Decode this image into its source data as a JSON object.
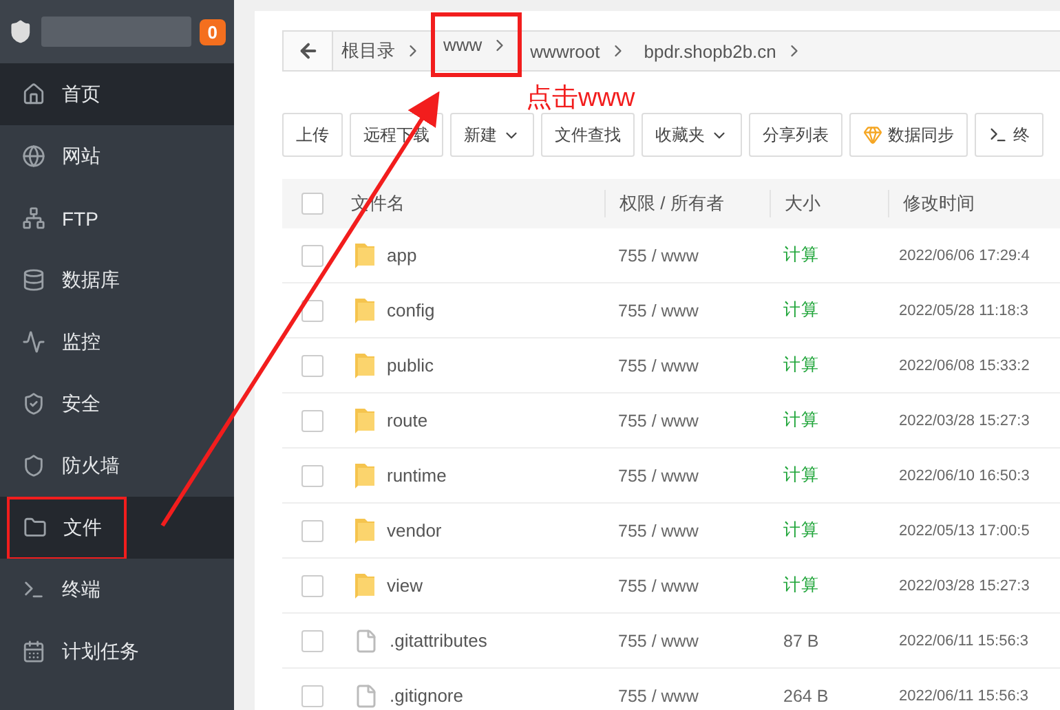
{
  "sidebar": {
    "badge": "0",
    "items": [
      {
        "label": "首页",
        "selected": true,
        "highlighted": false
      },
      {
        "label": "网站",
        "selected": false,
        "highlighted": false
      },
      {
        "label": "FTP",
        "selected": false,
        "highlighted": false
      },
      {
        "label": "数据库",
        "selected": false,
        "highlighted": false
      },
      {
        "label": "监控",
        "selected": false,
        "highlighted": false
      },
      {
        "label": "安全",
        "selected": false,
        "highlighted": false
      },
      {
        "label": "防火墙",
        "selected": false,
        "highlighted": false
      },
      {
        "label": "文件",
        "selected": true,
        "highlighted": true
      },
      {
        "label": "终端",
        "selected": false,
        "highlighted": false
      },
      {
        "label": "计划任务",
        "selected": false,
        "highlighted": false
      }
    ]
  },
  "breadcrumb": [
    {
      "label": "根目录",
      "highlighted": false
    },
    {
      "label": "www",
      "highlighted": true
    },
    {
      "label": "wwwroot",
      "highlighted": false
    },
    {
      "label": "bpdr.shopb2b.cn",
      "highlighted": false
    }
  ],
  "annotation": {
    "text": "点击www"
  },
  "toolbar": [
    {
      "label": "上传",
      "kind": "plain"
    },
    {
      "label": "远程下载",
      "kind": "plain"
    },
    {
      "label": "新建",
      "kind": "dropdown"
    },
    {
      "label": "文件查找",
      "kind": "plain"
    },
    {
      "label": "收藏夹",
      "kind": "dropdown"
    },
    {
      "label": "分享列表",
      "kind": "plain"
    },
    {
      "label": "数据同步",
      "kind": "gem"
    },
    {
      "label": "终",
      "kind": "terminal"
    }
  ],
  "table": {
    "select_all_checked": false,
    "columns": [
      "文件名",
      "权限 / 所有者",
      "大小",
      "修改时间"
    ],
    "rows": [
      {
        "kind": "folder",
        "name": "app",
        "perm": "755 / www",
        "size": "计算",
        "time": "2022/06/06 17:29:4",
        "checked": false
      },
      {
        "kind": "folder",
        "name": "config",
        "perm": "755 / www",
        "size": "计算",
        "time": "2022/05/28 11:18:3",
        "checked": false
      },
      {
        "kind": "folder",
        "name": "public",
        "perm": "755 / www",
        "size": "计算",
        "time": "2022/06/08 15:33:2",
        "checked": false
      },
      {
        "kind": "folder",
        "name": "route",
        "perm": "755 / www",
        "size": "计算",
        "time": "2022/03/28 15:27:3",
        "checked": false
      },
      {
        "kind": "folder",
        "name": "runtime",
        "perm": "755 / www",
        "size": "计算",
        "time": "2022/06/10 16:50:3",
        "checked": false
      },
      {
        "kind": "folder",
        "name": "vendor",
        "perm": "755 / www",
        "size": "计算",
        "time": "2022/05/13 17:00:5",
        "checked": false
      },
      {
        "kind": "folder",
        "name": "view",
        "perm": "755 / www",
        "size": "计算",
        "time": "2022/03/28 15:27:3",
        "checked": false
      },
      {
        "kind": "file",
        "name": ".gitattributes",
        "perm": "755 / www",
        "size": "87 B",
        "time": "2022/06/11 15:56:3",
        "checked": false
      },
      {
        "kind": "file",
        "name": ".gitignore",
        "perm": "755 / www",
        "size": "264 B",
        "time": "2022/06/11 15:56:3",
        "checked": false
      }
    ]
  }
}
